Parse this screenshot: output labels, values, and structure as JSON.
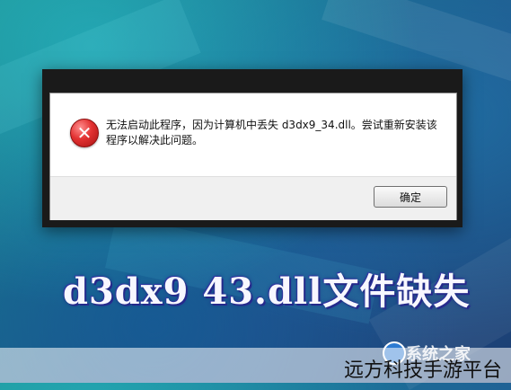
{
  "dialog": {
    "icon": "error-icon",
    "message": "无法启动此程序，因为计算机中丢失 d3dx9_34.dll。尝试重新安装该程序以解决此问题。",
    "ok_label": "确定"
  },
  "caption": "d3dx9 43.dll文件缺失",
  "watermark": {
    "logo_text": "系统之家",
    "site": "远方科技手游平台"
  },
  "colors": {
    "error_red": "#e23131",
    "background_teal": "#1d8a8e",
    "background_blue": "#22508a"
  }
}
